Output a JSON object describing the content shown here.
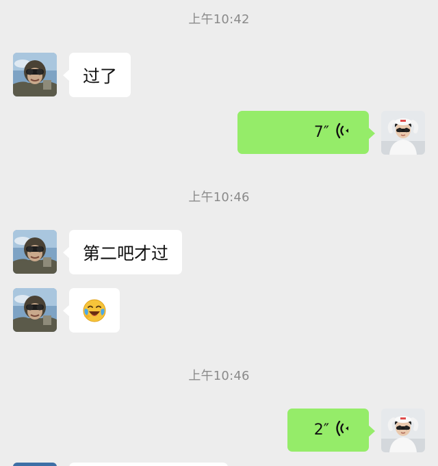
{
  "timestamps": {
    "t1": "上午10:42",
    "t2": "上午10:46",
    "t3": "上午10:46"
  },
  "messages": [
    {
      "direction": "incoming",
      "type": "text",
      "text": "过了"
    },
    {
      "direction": "outgoing",
      "type": "voice",
      "duration": "7″",
      "icon": "voice-wave-icon"
    },
    {
      "direction": "incoming",
      "type": "text",
      "text": "第二吧才过"
    },
    {
      "direction": "incoming",
      "type": "emoji",
      "emoji": "laugh-cry-emoji"
    },
    {
      "direction": "outgoing",
      "type": "voice",
      "duration": "2″",
      "icon": "voice-wave-icon"
    }
  ],
  "colors": {
    "background": "#ededed",
    "incoming_bubble": "#ffffff",
    "outgoing_bubble": "#95ec69",
    "timestamp_text": "#8a8a8a"
  }
}
